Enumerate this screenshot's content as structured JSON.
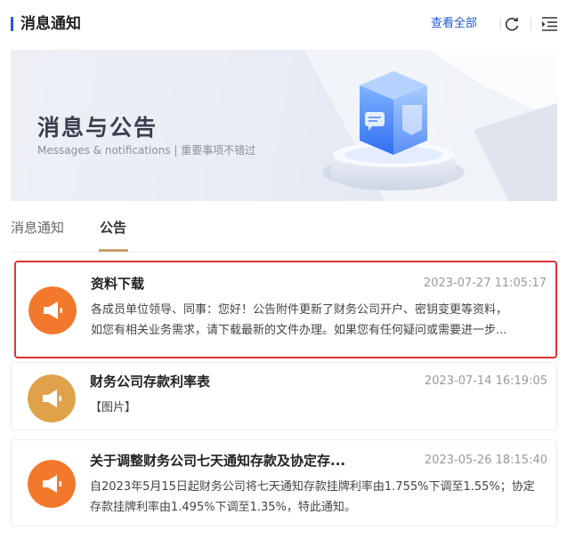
{
  "header": {
    "title": "消息通知",
    "view_all_label": "查看全部",
    "accent_color": "#1f5bd6"
  },
  "banner": {
    "title": "消息与公告",
    "subtitle": "Messages & notifications | 重要事项不错过"
  },
  "tabs": [
    {
      "label": "消息通知",
      "active": false
    },
    {
      "label": "公告",
      "active": true
    }
  ],
  "announcements": [
    {
      "title": "资料下载",
      "time": "2023-07-27 11:05:17",
      "line1": "各成员单位领导、同事：您好！公告附件更新了财务公司开户、密钥变更等资料，",
      "line2": "如您有相关业务需求，请下载最新的文件办理。如果您有任何疑问或需要进一步...",
      "icon": "megaphone-icon",
      "icon_color": "#f2792c",
      "selected": true
    },
    {
      "title": "财务公司存款利率表",
      "time": "2023-07-14 16:19:05",
      "line1": "【图片】",
      "line2": "",
      "icon": "megaphone-icon",
      "icon_color": "#dfa24a",
      "selected": false
    },
    {
      "title": "关于调整财务公司七天通知存款及协定存...",
      "time": "2023-05-26 18:15:40",
      "line1": "自2023年5月15日起财务公司将七天通知存款挂牌利率由1.755%下调至1.55%；协定",
      "line2": "存款挂牌利率由1.495%下调至1.35%，特此通知。",
      "icon": "megaphone-icon",
      "icon_color": "#f2792c",
      "selected": false
    }
  ]
}
